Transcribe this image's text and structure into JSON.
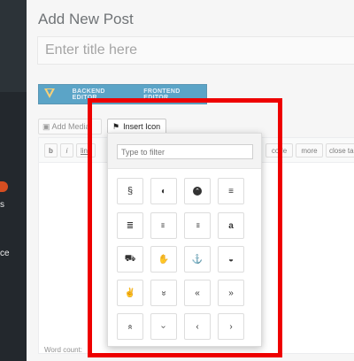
{
  "sidebar": {
    "fragments": [
      "s",
      "ce"
    ]
  },
  "page": {
    "title": "Add New Post"
  },
  "title_field": {
    "placeholder": "Enter title here"
  },
  "composer": {
    "backend_label": "BACKEND EDITOR",
    "frontend_label": "FRONTEND EDITOR"
  },
  "media": {
    "add_media_label": "Add Media",
    "insert_icon_label": "Insert Icon"
  },
  "quicktags": [
    "b",
    "i",
    "link",
    "code",
    "more",
    "close ta"
  ],
  "footer": {
    "word_count": "Word count:"
  },
  "icon_picker": {
    "filter_placeholder": "Type to filter",
    "rows": [
      [
        "scroll-icon",
        "half-circle-icon",
        "chevron-up-circle-icon",
        "align-center-icon"
      ],
      [
        "align-justify-icon",
        "align-left-icon",
        "align-right-icon",
        "amazon-icon"
      ],
      [
        "ambulance-icon",
        "american-sign-language-icon",
        "anchor-icon",
        "android-icon"
      ],
      [
        "angellist-icon",
        "angle-double-down-icon",
        "angle-double-left-icon",
        "angle-double-right-icon"
      ],
      [
        "angle-double-up-icon",
        "angle-down-icon",
        "angle-left-icon",
        "angle-right-icon"
      ]
    ],
    "glyphs": {
      "scroll-icon": "§",
      "half-circle-icon": "◐",
      "chevron-up-circle-icon": "⌃",
      "align-center-icon": "≡",
      "align-justify-icon": "≣",
      "align-left-icon": "≡",
      "align-right-icon": "≡",
      "amazon-icon": "a",
      "ambulance-icon": "⛟",
      "american-sign-language-icon": "✋",
      "anchor-icon": "⚓",
      "android-icon": "◒",
      "angellist-icon": "✌",
      "angle-double-down-icon": "»",
      "angle-double-left-icon": "«",
      "angle-double-right-icon": "»",
      "angle-double-up-icon": "«",
      "angle-down-icon": "›",
      "angle-left-icon": "‹",
      "angle-right-icon": "›"
    }
  },
  "colors": {
    "highlight": "#ee0000",
    "composer_bar": "#0473aa",
    "sidebar": "#23282d"
  }
}
